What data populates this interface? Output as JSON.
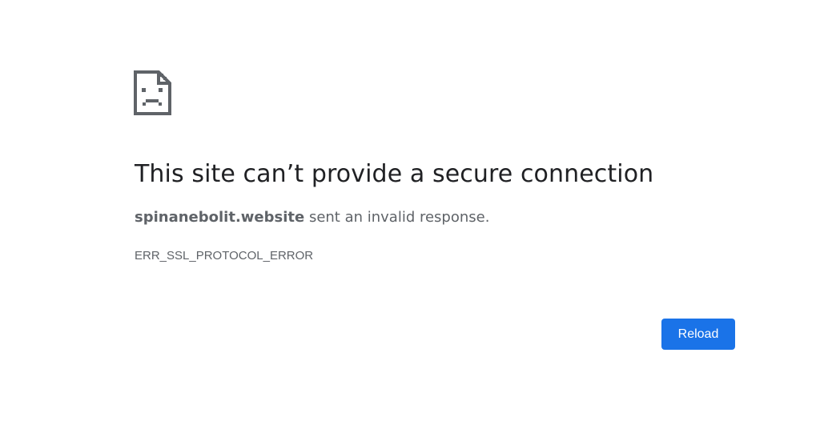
{
  "icon": "sad-page-icon",
  "title": "This site can’t provide a secure connection",
  "summary": {
    "host": "spinanebolit.website",
    "message": "sent an invalid response."
  },
  "error_code": "ERR_SSL_PROTOCOL_ERROR",
  "reload_button": {
    "label": "Reload"
  },
  "colors": {
    "accent": "#1a73e8",
    "title": "#202124",
    "secondary_text": "#5f6368",
    "icon": "#5f6368"
  }
}
